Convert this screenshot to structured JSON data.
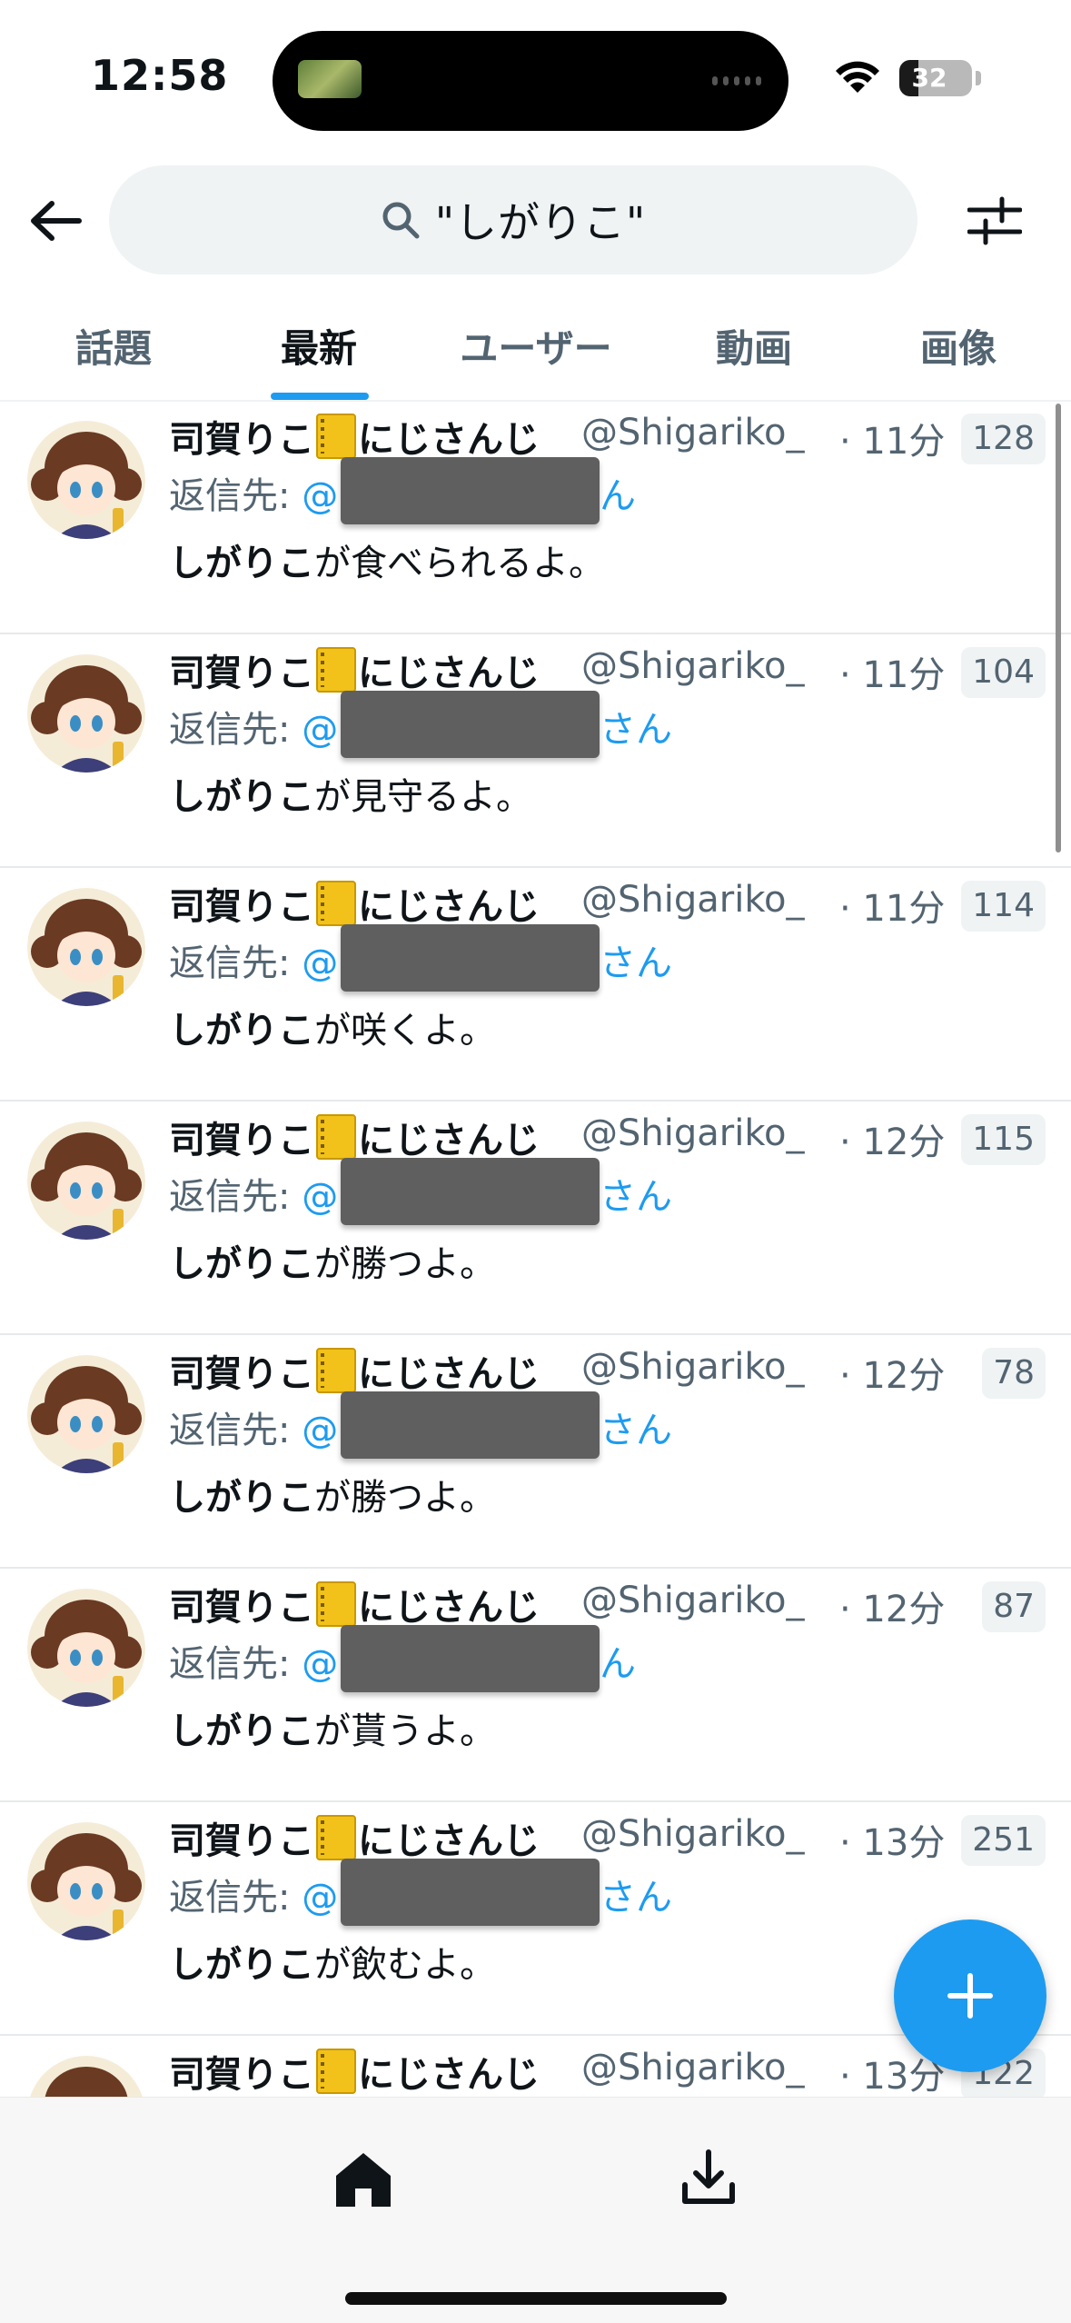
{
  "status_bar": {
    "time": "12:58",
    "battery": "32",
    "battery_level": 0.32
  },
  "search": {
    "query": "\"しがりこ\""
  },
  "tabs": [
    {
      "label": "話題",
      "active": false
    },
    {
      "label": "最新",
      "active": true
    },
    {
      "label": "ユーザー",
      "active": false
    },
    {
      "label": "動画",
      "active": false
    },
    {
      "label": "画像",
      "active": false
    }
  ],
  "tweets": [
    {
      "name_pre": "司賀りこ",
      "name_post": "にじさんじ",
      "handle": "@Shigariko_",
      "time": "· 11分",
      "count": "128",
      "reply_label": "返信先: ",
      "reply_at": "@",
      "reply_suffix": "ん",
      "body_bold": "しがりこ",
      "body_rest": "が食べられるよ。"
    },
    {
      "name_pre": "司賀りこ",
      "name_post": "にじさんじ",
      "handle": "@Shigariko_",
      "time": "· 11分",
      "count": "104",
      "reply_label": "返信先: ",
      "reply_at": "@",
      "reply_suffix": "さん",
      "body_bold": "しがりこ",
      "body_rest": "が見守るよ。"
    },
    {
      "name_pre": "司賀りこ",
      "name_post": "にじさんじ",
      "handle": "@Shigariko_",
      "time": "· 11分",
      "count": "114",
      "reply_label": "返信先: ",
      "reply_at": "@",
      "reply_suffix": "さん",
      "body_bold": "しがりこ",
      "body_rest": "が咲くよ。"
    },
    {
      "name_pre": "司賀りこ",
      "name_post": "にじさんじ",
      "handle": "@Shigariko_",
      "time": "· 12分",
      "count": "115",
      "reply_label": "返信先: ",
      "reply_at": "@",
      "reply_suffix": "さん",
      "body_bold": "しがりこ",
      "body_rest": "が勝つよ。"
    },
    {
      "name_pre": "司賀りこ",
      "name_post": "にじさんじ",
      "handle": "@Shigariko_",
      "time": "· 12分",
      "count": "78",
      "reply_label": "返信先: ",
      "reply_at": "@",
      "reply_suffix": "さん",
      "body_bold": "しがりこ",
      "body_rest": "が勝つよ。"
    },
    {
      "name_pre": "司賀りこ",
      "name_post": "にじさんじ",
      "handle": "@Shigariko_",
      "time": "· 12分",
      "count": "87",
      "reply_label": "返信先: ",
      "reply_at": "@",
      "reply_suffix": "ん",
      "body_bold": "しがりこ",
      "body_rest": "が貰うよ。"
    },
    {
      "name_pre": "司賀りこ",
      "name_post": "にじさんじ",
      "handle": "@Shigariko_",
      "time": "· 13分",
      "count": "251",
      "reply_label": "返信先: ",
      "reply_at": "@",
      "reply_suffix": "さん",
      "body_bold": "しがりこ",
      "body_rest": "が飲むよ。"
    },
    {
      "name_pre": "司賀りこ",
      "name_post": "にじさんじ",
      "handle": "@Shigariko_",
      "time": "· 13分",
      "count": "122",
      "reply_label": "",
      "reply_at": "",
      "reply_suffix": "",
      "body_bold": "",
      "body_rest": ""
    }
  ],
  "icons": {
    "back": "arrow-left-icon",
    "search": "search-icon",
    "filter": "sliders-icon",
    "compose": "plus-icon",
    "home": "home-icon",
    "download": "download-icon"
  },
  "colors": {
    "accent": "#1d9bf0",
    "text": "#0f1419",
    "secondary": "#536471"
  }
}
